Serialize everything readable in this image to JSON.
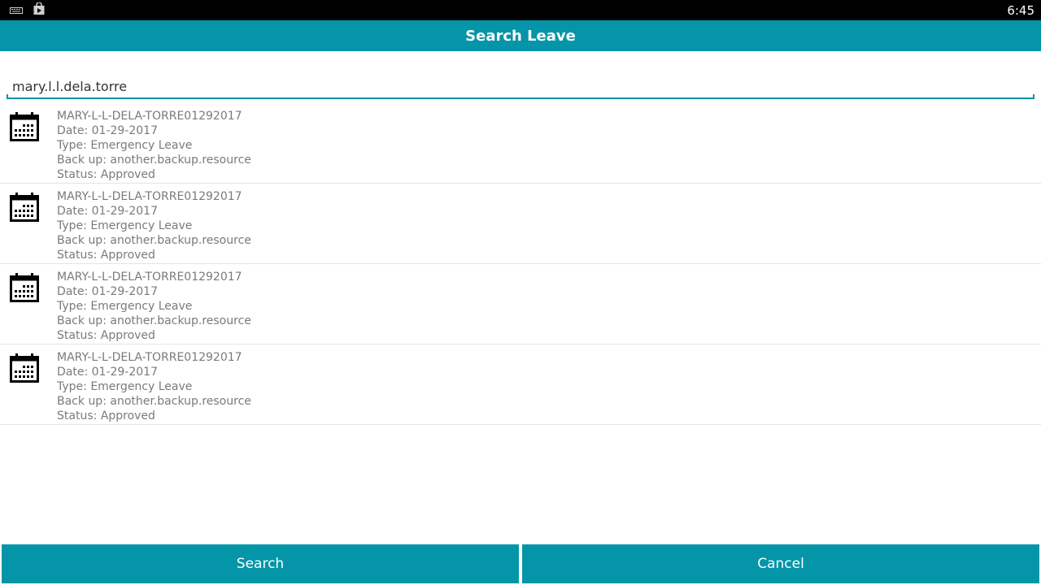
{
  "status_bar": {
    "time": "6:45",
    "icons": [
      "keyboard-icon",
      "play-store-bag-icon"
    ]
  },
  "header": {
    "title": "Search Leave"
  },
  "search": {
    "value": "mary.l.l.dela.torre"
  },
  "results": [
    {
      "icon": "calendar-icon",
      "id": "MARY-L-L-DELA-TORRE01292017",
      "date": "Date: 01-29-2017",
      "type": "Type: Emergency Leave",
      "backup": "Back up: another.backup.resource",
      "status": "Status: Approved"
    },
    {
      "icon": "calendar-icon",
      "id": "MARY-L-L-DELA-TORRE01292017",
      "date": "Date: 01-29-2017",
      "type": "Type: Emergency Leave",
      "backup": "Back up: another.backup.resource",
      "status": "Status: Approved"
    },
    {
      "icon": "calendar-icon",
      "id": "MARY-L-L-DELA-TORRE01292017",
      "date": "Date: 01-29-2017",
      "type": "Type: Emergency Leave",
      "backup": "Back up: another.backup.resource",
      "status": "Status: Approved"
    },
    {
      "icon": "calendar-icon",
      "id": "MARY-L-L-DELA-TORRE01292017",
      "date": "Date: 01-29-2017",
      "type": "Type: Emergency Leave",
      "backup": "Back up: another.backup.resource",
      "status": "Status: Approved"
    }
  ],
  "buttons": {
    "search_label": "Search",
    "cancel_label": "Cancel"
  },
  "colors": {
    "accent": "#0595a8",
    "status_bar": "#000000",
    "item_text": "#7a7a7a"
  }
}
